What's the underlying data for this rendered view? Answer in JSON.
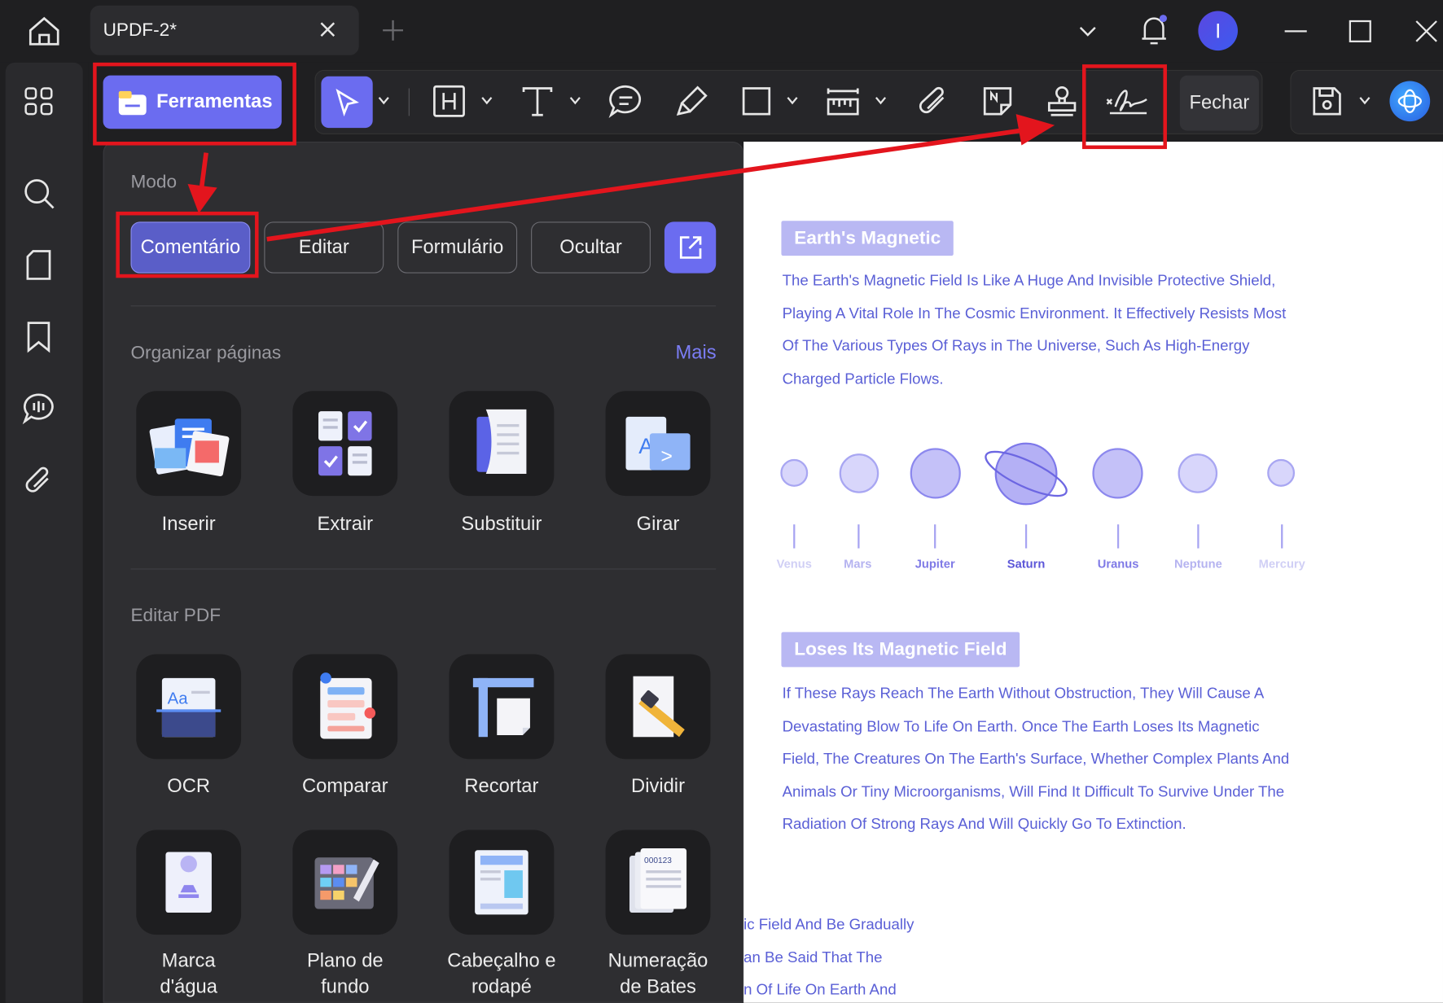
{
  "tab": {
    "title": "UPDF-2*"
  },
  "user": {
    "avatar_letter": "I"
  },
  "toolbar": {
    "tools_label": "Ferramentas",
    "close_label": "Fechar"
  },
  "panel": {
    "mode_title": "Modo",
    "modes": [
      "Comentário",
      "Editar",
      "Formulário",
      "Ocultar"
    ],
    "organize_title": "Organizar páginas",
    "more_label": "Mais",
    "organize_items": [
      "Inserir",
      "Extrair",
      "Substituir",
      "Girar"
    ],
    "edit_title": "Editar PDF",
    "edit_items": [
      "OCR",
      "Comparar",
      "Recortar",
      "Dividir"
    ],
    "edit_items_2": [
      "Marca\nd'água",
      "Plano de\nfundo",
      "Cabeçalho e\nrodapé",
      "Numeração\nde Bates"
    ]
  },
  "document": {
    "heading1": "Earth's Magnetic",
    "para1": [
      "The Earth's Magnetic Field Is Like A Huge And Invisible Protective Shield,",
      "Playing A Vital Role In The Cosmic Environment. It Effectively Resists Most",
      "Of The Various Types Of Rays in The Universe, Such As High-Energy",
      "Charged Particle Flows."
    ],
    "planets": [
      "Venus",
      "Mars",
      "Jupiter",
      "Saturn",
      "Uranus",
      "Neptune",
      "Mercury"
    ],
    "heading2": "Loses Its Magnetic Field",
    "para2": [
      "If These Rays Reach The Earth Without Obstruction, They Will Cause A",
      "Devastating Blow To Life On Earth. Once The Earth Loses Its Magnetic",
      "Field, The Creatures On The Earth's Surface, Whether Complex Plants And",
      "Animals Or Tiny Microorganisms, Will Find It Difficult To Survive Under The",
      "Radiation Of Strong Rays And Will Quickly Go To Extinction."
    ],
    "fragments": [
      "ic Field And Be Gradually",
      "an Be Said That The",
      "n Of Life On Earth And"
    ]
  },
  "colors": {
    "accent": "#6b6cf0",
    "annotation_red": "#e3151d",
    "doc_text": "#5a5fd6"
  }
}
